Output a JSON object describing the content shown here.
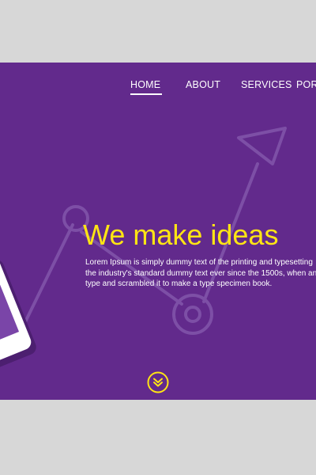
{
  "nav": {
    "items": [
      "HOME",
      "ABOUT",
      "SERVICES",
      "PORTFOLIO"
    ],
    "active_index": 0
  },
  "hero": {
    "headline": "We make ideas",
    "body_lines": [
      "Lorem Ipsum is simply dummy text of the printing and typesetting",
      "the industry's standard dummy text ever since the 1500s, when an",
      "type and scrambled it to make a type specimen book."
    ]
  },
  "colors": {
    "page_background": "#d7d7d7",
    "hero_background": "#622a8c",
    "accent": "#ffe514",
    "text": "#ffffff"
  },
  "icons": {
    "scroll_down": "double-chevron-down-icon",
    "phone": "smartphone-icon",
    "growth_arrow": "trend-arrow-icon"
  }
}
